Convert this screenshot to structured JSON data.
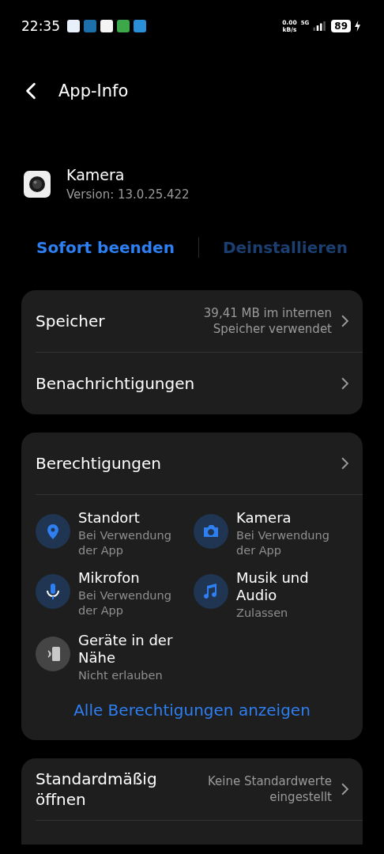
{
  "status_bar": {
    "time": "22:35",
    "notification_icons": [
      {
        "color": "#e8f0fb"
      },
      {
        "color": "#1c6fa8"
      },
      {
        "color": "#f4f4f4"
      },
      {
        "color": "#3ca84a"
      },
      {
        "color": "#2a8fd6"
      }
    ],
    "speed_value": "0.00",
    "speed_unit": "kB/s",
    "network": "5G",
    "battery": "89",
    "charging": true
  },
  "header": {
    "title": "App-Info"
  },
  "app": {
    "name": "Kamera",
    "version": "Version: 13.0.25.422"
  },
  "actions": [
    {
      "label": "Sofort beenden",
      "disabled": false
    },
    {
      "label": "Deinstallieren",
      "disabled": true
    }
  ],
  "settings_card": [
    {
      "label": "Speicher",
      "value": "39,41 MB im internen Speicher verwendet"
    },
    {
      "label": "Benachrichtigungen"
    }
  ],
  "permissions": {
    "title": "Berechtigungen",
    "items": [
      {
        "kind": "location",
        "name": "Standort",
        "status": "Bei Verwendung der App",
        "allowed": true
      },
      {
        "kind": "camera",
        "name": "Kamera",
        "status": "Bei Verwendung der App",
        "allowed": true
      },
      {
        "kind": "microphone",
        "name": "Mikrofon",
        "status": "Bei Verwendung der App",
        "allowed": true
      },
      {
        "kind": "music",
        "name": "Musik und Audio",
        "status": "Zulassen",
        "allowed": true
      },
      {
        "kind": "nearby",
        "name": "Geräte in der Nähe",
        "status": "Nicht erlauben",
        "allowed": false
      }
    ],
    "show_all": "Alle Berechtigungen anzeigen"
  },
  "defaults_card": [
    {
      "label": "Standardmäßig öffnen",
      "value": "Keine Standardwerte eingestellt"
    }
  ]
}
